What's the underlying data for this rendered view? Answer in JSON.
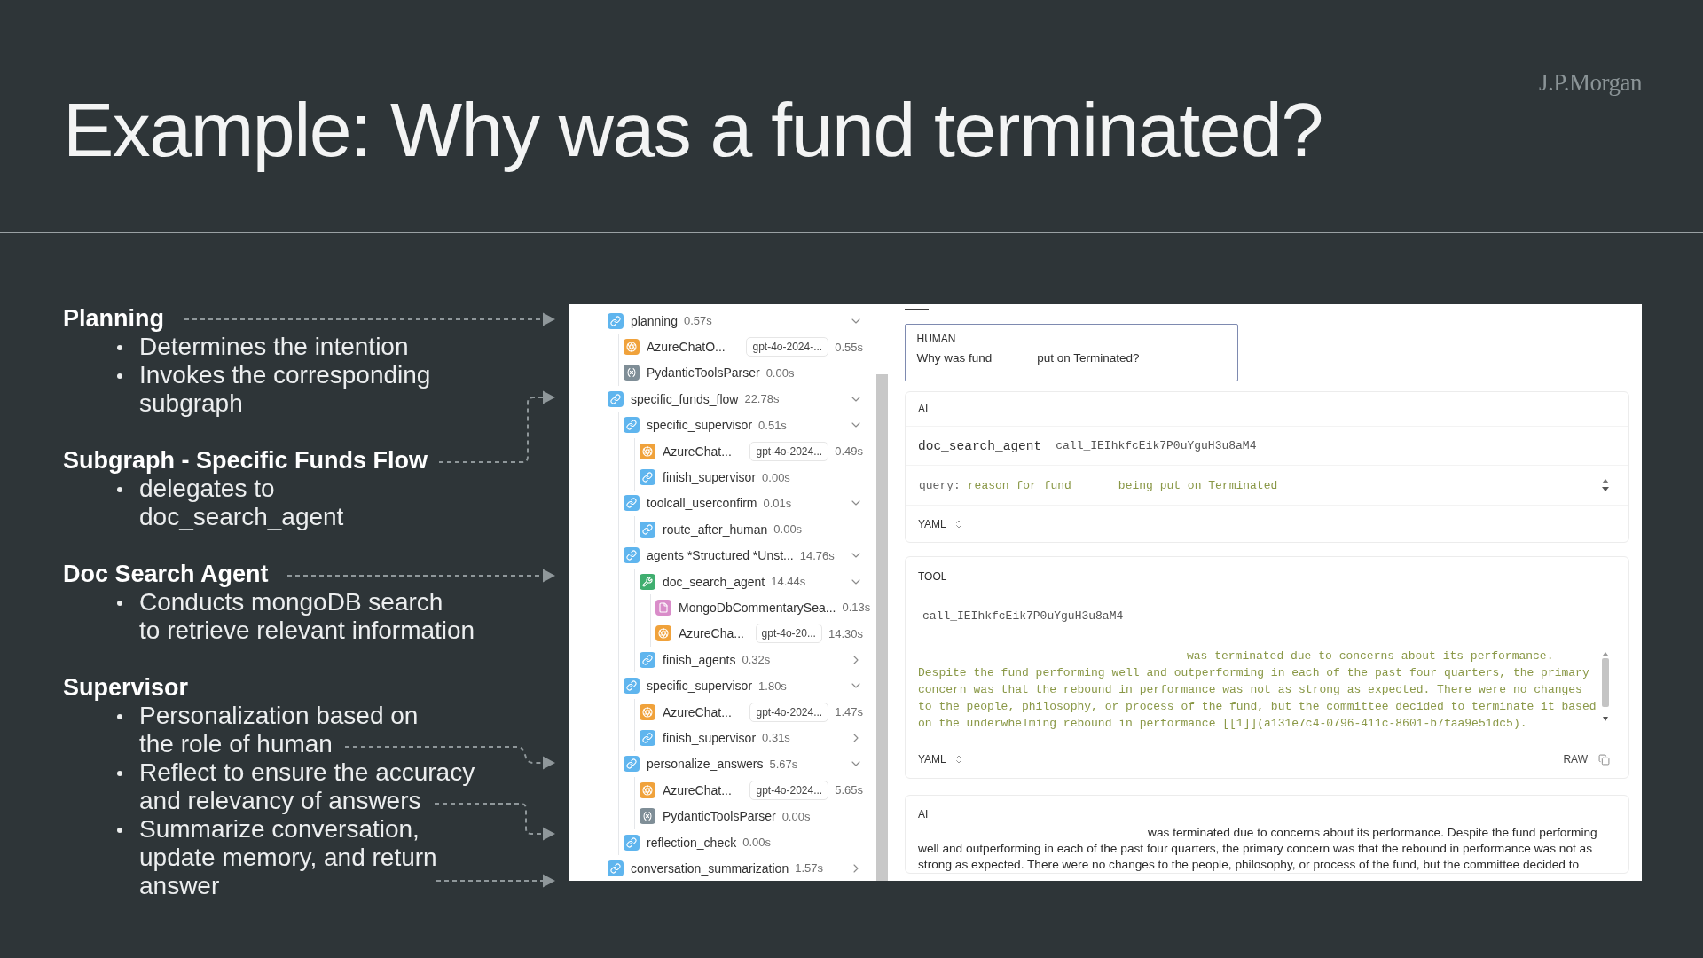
{
  "slide": {
    "title": "Example: Why was a fund terminated?",
    "logo": "J.P.Morgan"
  },
  "sections": [
    {
      "heading": "Planning",
      "bullets": [
        "Determines the intention",
        "Invokes the corresponding\nsubgraph"
      ]
    },
    {
      "heading": "Subgraph - Specific Funds Flow",
      "bullets": [
        "delegates to\ndoc_search_agent"
      ]
    },
    {
      "heading": "Doc Search Agent",
      "bullets": [
        "Conducts mongoDB search\nto retrieve relevant information"
      ]
    },
    {
      "heading": "Supervisor",
      "bullets": [
        "Personalization based on\nthe role of human",
        "Reflect to ensure the accuracy\nand relevancy of answers",
        "Summarize conversation,\nupdate memory, and return\nanswer"
      ]
    }
  ],
  "trace_tree": [
    {
      "name": "planning",
      "duration": "0.57s",
      "kind": "chain",
      "expanded": true,
      "children": [
        {
          "name": "AzureChatO...",
          "model": "gpt-4o-2024-...",
          "duration": "0.55s",
          "kind": "llm"
        },
        {
          "name": "PydanticToolsParser",
          "duration": "0.00s",
          "kind": "parser"
        }
      ]
    },
    {
      "name": "specific_funds_flow",
      "duration": "22.78s",
      "kind": "chain",
      "expanded": true,
      "children": [
        {
          "name": "specific_supervisor",
          "duration": "0.51s",
          "kind": "chain",
          "expanded": true,
          "children": [
            {
              "name": "AzureChat...",
              "model": "gpt-4o-2024...",
              "duration": "0.49s",
              "kind": "llm"
            },
            {
              "name": "finish_supervisor",
              "duration": "0.00s",
              "kind": "chain"
            }
          ]
        },
        {
          "name": "toolcall_userconfirm",
          "duration": "0.01s",
          "kind": "chain",
          "expanded": true,
          "children": [
            {
              "name": "route_after_human",
              "duration": "0.00s",
              "kind": "chain"
            }
          ]
        },
        {
          "name": "agents *Structured *Unst...",
          "duration": "14.76s",
          "kind": "chain",
          "expanded": true,
          "children": [
            {
              "name": "doc_search_agent",
              "duration": "14.44s",
              "kind": "tool",
              "expanded": true,
              "children": [
                {
                  "name": "MongoDbCommentarySea...",
                  "duration": "0.13s",
                  "kind": "retriever"
                },
                {
                  "name": "AzureCha...",
                  "model": "gpt-4o-20...",
                  "duration": "14.30s",
                  "kind": "llm"
                }
              ]
            },
            {
              "name": "finish_agents",
              "duration": "0.32s",
              "kind": "chain",
              "expanded": false
            }
          ]
        },
        {
          "name": "specific_supervisor",
          "duration": "1.80s",
          "kind": "chain",
          "expanded": true,
          "children": [
            {
              "name": "AzureChat...",
              "model": "gpt-4o-2024...",
              "duration": "1.47s",
              "kind": "llm"
            },
            {
              "name": "finish_supervisor",
              "duration": "0.31s",
              "kind": "chain",
              "expanded": false
            }
          ]
        },
        {
          "name": "personalize_answers",
          "duration": "5.67s",
          "kind": "chain",
          "expanded": true,
          "children": [
            {
              "name": "AzureChat...",
              "model": "gpt-4o-2024...",
              "duration": "5.65s",
              "kind": "llm"
            },
            {
              "name": "PydanticToolsParser",
              "duration": "0.00s",
              "kind": "parser"
            }
          ]
        },
        {
          "name": "reflection_check",
          "duration": "0.00s",
          "kind": "chain"
        }
      ]
    },
    {
      "name": "conversation_summarization",
      "duration": "1.57s",
      "kind": "chain",
      "expanded": false
    }
  ],
  "messages": [
    {
      "kind": "human",
      "role": "HUMAN",
      "text_parts": [
        "Why was fund",
        "put on Terminated?"
      ]
    },
    {
      "kind": "tool_call",
      "role": "AI",
      "tool_name": "doc_search_agent",
      "call_id": "call_IEIhkfcEik7P0uYguH3u8aM4",
      "args": [
        {
          "key": "query:",
          "value_parts": [
            "reason for fund",
            "being put on Terminated"
          ]
        }
      ],
      "format": "YAML"
    },
    {
      "kind": "tool_result",
      "role": "TOOL",
      "call_id": "call_IEIhkfcEik7P0uYguH3u8aM4",
      "lines": [
        "was terminated due to concerns about its performance.",
        "Despite the fund performing well and outperforming in each of the past four quarters, the primary",
        "concern was that the rebound in performance was not as strong as expected. There were no changes",
        "to the people, philosophy, or process of the fund, but the committee decided to terminate it based",
        "on the underwhelming rebound in performance [[1]](a131e7c4-0796-411c-8601-b7faa9e51dc5)."
      ],
      "format": "YAML",
      "raw_label": "RAW"
    },
    {
      "kind": "answer",
      "role": "AI",
      "lines": [
        "was terminated due to concerns about its performance. Despite the fund performing",
        "well and outperforming in each of the past four quarters, the primary concern was that the rebound in performance was not as",
        "strong as expected. There were no changes to the people, philosophy, or process of the fund, but the committee decided to"
      ]
    }
  ]
}
